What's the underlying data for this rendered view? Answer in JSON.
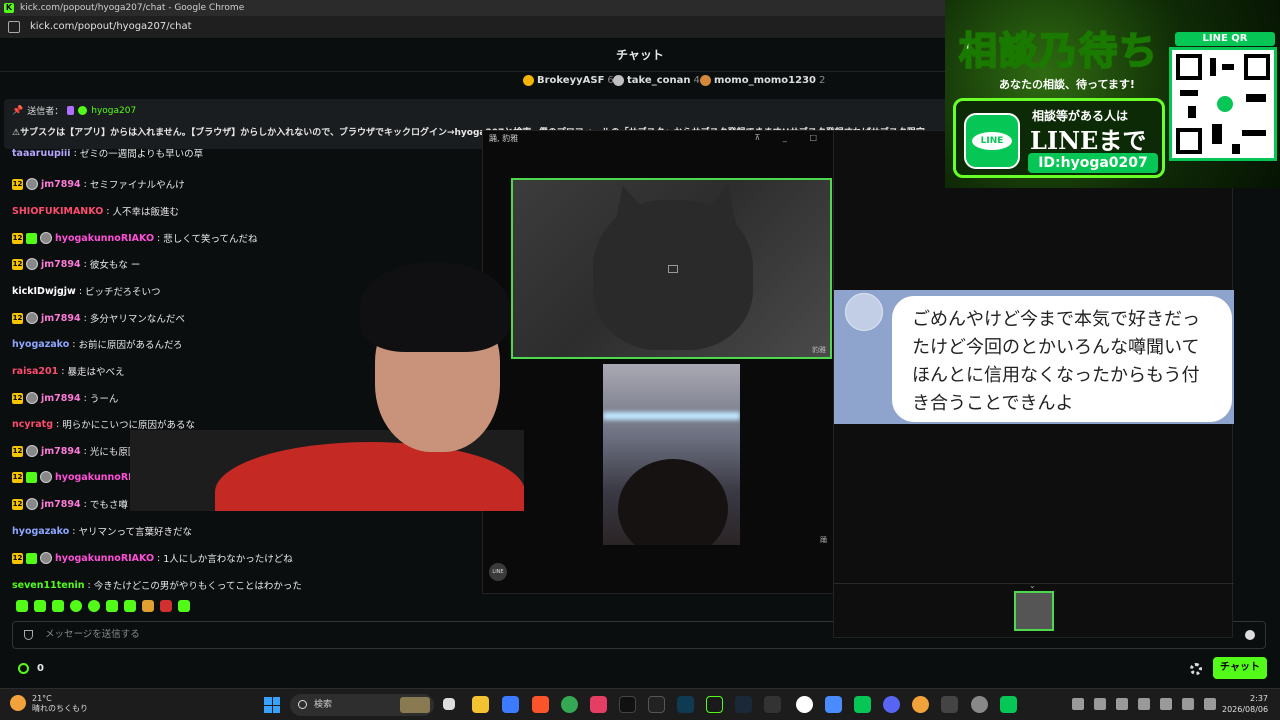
{
  "browser": {
    "window_title": "kick.com/popout/hyoga207/chat - Google Chrome",
    "url": "kick.com/popout/hyoga207/chat"
  },
  "chat": {
    "header_title": "チャット",
    "top_gifters": [
      {
        "name": "BrokeyyASF",
        "count": "6",
        "color": "#f5b400"
      },
      {
        "name": "take_conan",
        "count": "4",
        "color": "#c0c0c0"
      },
      {
        "name": "momo_momo1230",
        "count": "2",
        "color": "#d4893a"
      }
    ],
    "pinned": {
      "label": "送信者：",
      "user": "hyoga207",
      "text": "⚠サブスクは【アプリ】からは入れません。【ブラウザ】からしか入れないので、ブラウザでキックログイン→hyoga207と検索→僕のプロフィールの「サブスク」からサブスク登録できます!!サブスク登録すればサブスク限定"
    },
    "messages": [
      {
        "badges": [],
        "user": "taaaruupiii",
        "color": "#b6a6ff",
        "text": "ゼミの一週間よりも早いの草"
      },
      {
        "badges": [
          "sub12",
          "avatar"
        ],
        "user": "jm7894",
        "color": "#ff7ad9",
        "text": "セミファイナルやんけ"
      },
      {
        "badges": [],
        "user": "SHIOFUKIMANKO",
        "color": "#ff4b6e",
        "text": "人不幸は飯進む"
      },
      {
        "badges": [
          "sub12",
          "gift",
          "avatar"
        ],
        "user": "hyogakunnoRIAKO",
        "color": "#ff4fd8",
        "text": "悲しくて笑ってんだね"
      },
      {
        "badges": [
          "sub12",
          "avatar"
        ],
        "user": "jm7894",
        "color": "#ff7ad9",
        "text": "彼女もな ー"
      },
      {
        "badges": [],
        "user": "kickIDwjgjw",
        "color": "#ffffff",
        "text": "ビッチだろそいつ"
      },
      {
        "badges": [
          "sub12",
          "avatar"
        ],
        "user": "jm7894",
        "color": "#ff7ad9",
        "text": "多分ヤリマンなんだべ"
      },
      {
        "badges": [],
        "user": "hyogazako",
        "color": "#8ea6ff",
        "text": "お前に原因があるんだろ"
      },
      {
        "badges": [],
        "user": "raisa201",
        "color": "#ff4b6e",
        "text": "暴走はやべえ"
      },
      {
        "badges": [
          "sub12",
          "avatar"
        ],
        "user": "jm7894",
        "color": "#ff7ad9",
        "text": "うーん"
      },
      {
        "badges": [],
        "user": "ncyratg",
        "color": "#ff4b6e",
        "text": "明らかにこいつに原因があるな"
      },
      {
        "badges": [
          "sub12",
          "avatar"
        ],
        "user": "jm7894",
        "color": "#ff7ad9",
        "text": "光にも原因"
      },
      {
        "badges": [
          "sub12",
          "gift",
          "avatar"
        ],
        "user": "hyogakunnoRIA",
        "color": "#ff4fd8",
        "text": ""
      },
      {
        "badges": [
          "sub12",
          "avatar"
        ],
        "user": "jm7894",
        "color": "#ff7ad9",
        "text": "でもさ噂"
      },
      {
        "badges": [],
        "user": "hyogazako",
        "color": "#8ea6ff",
        "text": "ヤリマンって言葉好きだな"
      },
      {
        "badges": [
          "sub12",
          "gift",
          "avatar"
        ],
        "user": "hyogakunnoRIAKO",
        "color": "#ff4fd8",
        "text": "1人にしか言わなかったけどね"
      },
      {
        "badges": [],
        "user": "seven11tenin",
        "color": "#53fc18",
        "text": "今きたけどこの男がやりもくってことはわかった"
      }
    ],
    "sub_badge_text": "12",
    "input_placeholder": "メッセージを送信する",
    "points": "0",
    "chat_button": "チャット"
  },
  "call": {
    "window_title": "踊, 豹雅",
    "remote_name": "豹雅",
    "small_label": "踊",
    "line_logo": "LINE"
  },
  "line_chat": {
    "message": "ごめんやけど今まで本気で好きだったけど今回のとかいろんな噂聞いてほんとに信用なくなったからもう付き合うことできんよ"
  },
  "ad": {
    "title": "相談乃待ち",
    "subtitle": "あなたの相談、待ってます!",
    "line_text1": "相談等がある人は",
    "line_text2": "LINEまで",
    "line_id": "ID:hyoga0207",
    "qr_label": "LINE QR",
    "logo_text": "LINE"
  },
  "taskbar": {
    "temperature": "21°C",
    "weather": "晴れのちくもり",
    "search_placeholder": "検索",
    "time": "2:37",
    "date": "2026/08/06"
  },
  "colors": {
    "accent": "#53fc18",
    "line_green": "#06c755"
  }
}
